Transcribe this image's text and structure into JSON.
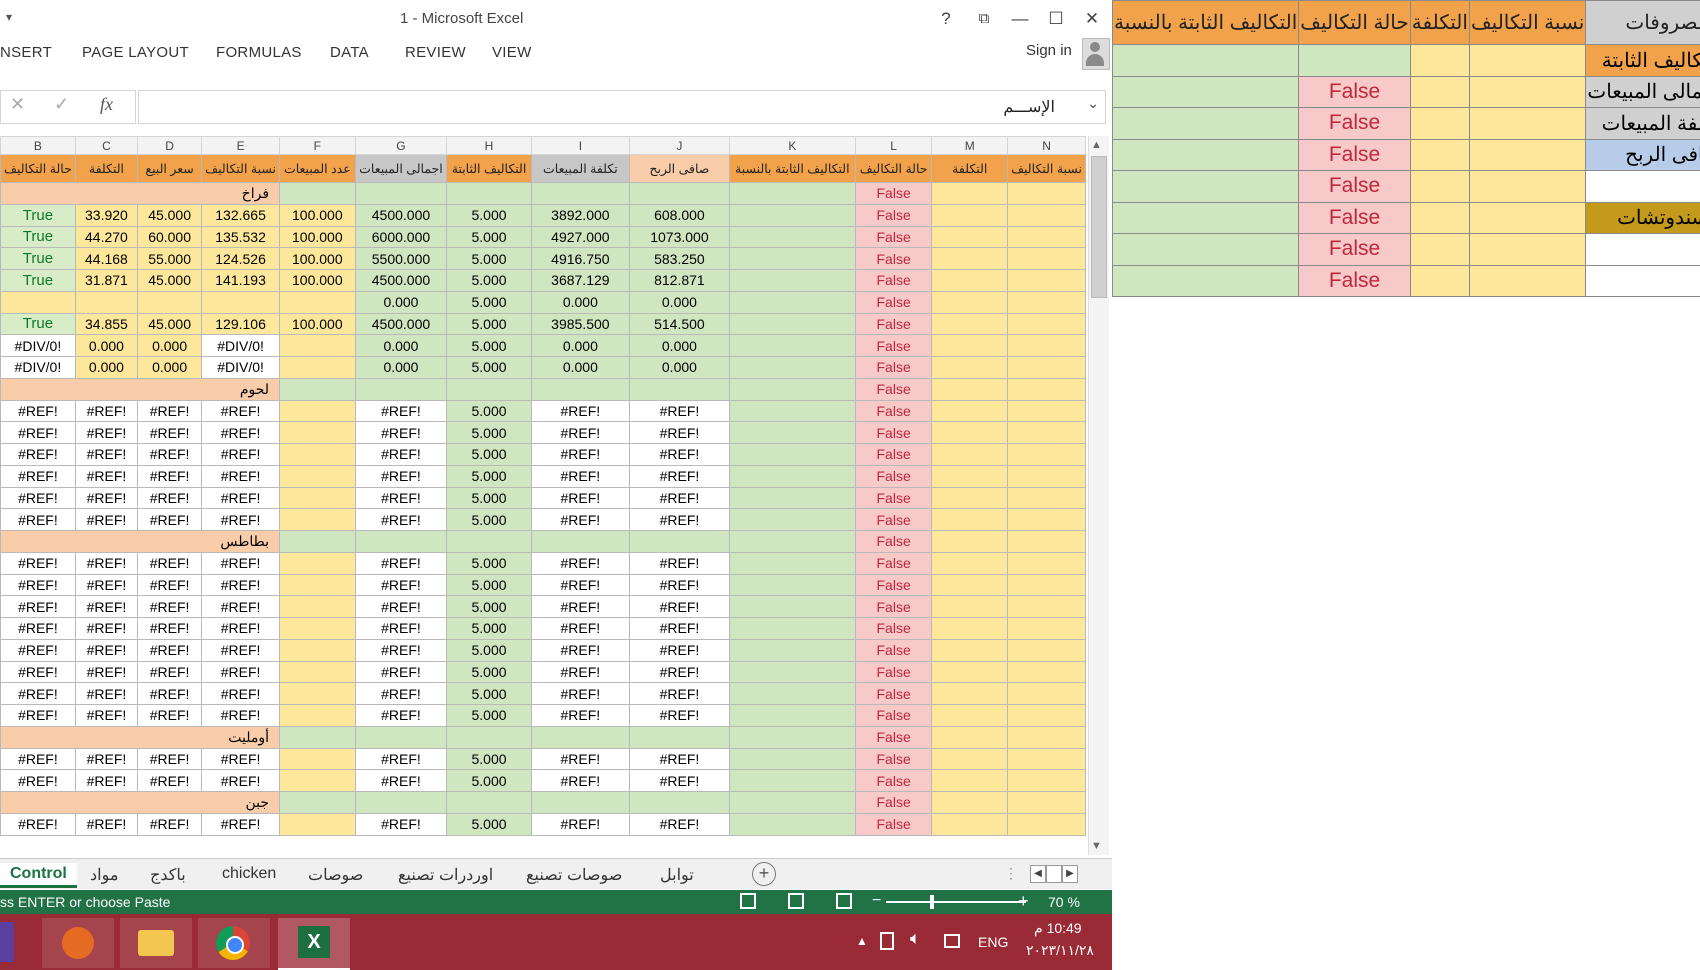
{
  "window": {
    "title": "1 - Microsoft Excel",
    "qat": "▾",
    "help": "?",
    "restore": "⧉",
    "minimize": "—",
    "maximize": "☐",
    "close": "✕"
  },
  "ribbon": {
    "tabs": [
      "NSERT",
      "PAGE LAYOUT",
      "FORMULAS",
      "DATA",
      "REVIEW",
      "VIEW"
    ],
    "signin": "Sign in"
  },
  "formula_bar": {
    "cancel": "✕",
    "enter": "✓",
    "fx": "fx",
    "value": "الإســـم",
    "expand": "⌄"
  },
  "columns": [
    "B",
    "C",
    "D",
    "E",
    "F",
    "G",
    "H",
    "I",
    "J",
    "K",
    "L",
    "M",
    "N"
  ],
  "headers": [
    "حالة التكاليف",
    "التكلفة",
    "سعر البيع",
    "نسبة التكاليف",
    "عدد المبيعات",
    "اجمالى المبيعات",
    "التكاليف الثابتة",
    "تكلفة المبيعات",
    "صافى الربح",
    "التكاليف الثابتة بالنسبة",
    "حالة التكاليف",
    "التكلفة",
    "نسبة التكاليف"
  ],
  "section_labels": {
    "s1": "فراخ",
    "s2": "لحوم",
    "s3": "بطاطس",
    "s4": "أومليت",
    "s5": "جبن"
  },
  "rows1": [
    [
      "True",
      "33.920",
      "45.000",
      "132.665",
      "100.000",
      "4500.000",
      "5.000",
      "3892.000",
      "608.000",
      "",
      "False",
      "",
      ""
    ],
    [
      "True",
      "44.270",
      "60.000",
      "135.532",
      "100.000",
      "6000.000",
      "5.000",
      "4927.000",
      "1073.000",
      "",
      "False",
      "",
      ""
    ],
    [
      "True",
      "44.168",
      "55.000",
      "124.526",
      "100.000",
      "5500.000",
      "5.000",
      "4916.750",
      "583.250",
      "",
      "False",
      "",
      ""
    ],
    [
      "True",
      "31.871",
      "45.000",
      "141.193",
      "100.000",
      "4500.000",
      "5.000",
      "3687.129",
      "812.871",
      "",
      "False",
      "",
      ""
    ],
    [
      "",
      "",
      "",
      "",
      "",
      "0.000",
      "5.000",
      "0.000",
      "0.000",
      "",
      "False",
      "",
      ""
    ],
    [
      "True",
      "34.855",
      "45.000",
      "129.106",
      "100.000",
      "4500.000",
      "5.000",
      "3985.500",
      "514.500",
      "",
      "False",
      "",
      ""
    ],
    [
      "#DIV/0!",
      "0.000",
      "0.000",
      "#DIV/0!",
      "",
      "0.000",
      "5.000",
      "0.000",
      "0.000",
      "",
      "False",
      "",
      ""
    ],
    [
      "#DIV/0!",
      "0.000",
      "0.000",
      "#DIV/0!",
      "",
      "0.000",
      "5.000",
      "0.000",
      "0.000",
      "",
      "False",
      "",
      ""
    ]
  ],
  "ref_row": [
    "#REF!",
    "#REF!",
    "#REF!",
    "#REF!",
    "",
    "#REF!",
    "5.000",
    "#REF!",
    "#REF!",
    "",
    "False",
    "",
    ""
  ],
  "false_text": "False",
  "sheet_tabs": [
    "Control",
    "مواد",
    "باكدج",
    "chicken",
    "صوصات",
    "اوردرات تصنيع",
    "صوصات تصنيع",
    "توابل"
  ],
  "status": {
    "message": "ss ENTER or choose Paste",
    "zoom": "70 %"
  },
  "taskbar": {
    "lang": "ENG",
    "time": "10:49 م",
    "date": "٢٠٢٣/١١/٢٨",
    "excel_label": "X"
  },
  "right_sheet": {
    "headers": [
      "التكاليف الثابتة بالنسبة",
      "حالة التكاليف",
      "التكلفة",
      "نسبة التكاليف",
      "المصروفات"
    ],
    "labels": [
      "التكاليف الثابتة",
      "اجمالى المبيعات",
      "تكلفة المبيعات",
      "صافى الربح",
      "",
      "السندوتشات",
      "",
      ""
    ],
    "false_text": "False"
  },
  "colors": {
    "excel_green": "#217346",
    "header_orange": "#f2a24a",
    "cell_yellow": "#fce79a",
    "cell_green": "#cfe6c1",
    "false_pink": "#f7c9c9",
    "section_peach": "#f9cda9",
    "taskbar": "#9a2b36"
  }
}
